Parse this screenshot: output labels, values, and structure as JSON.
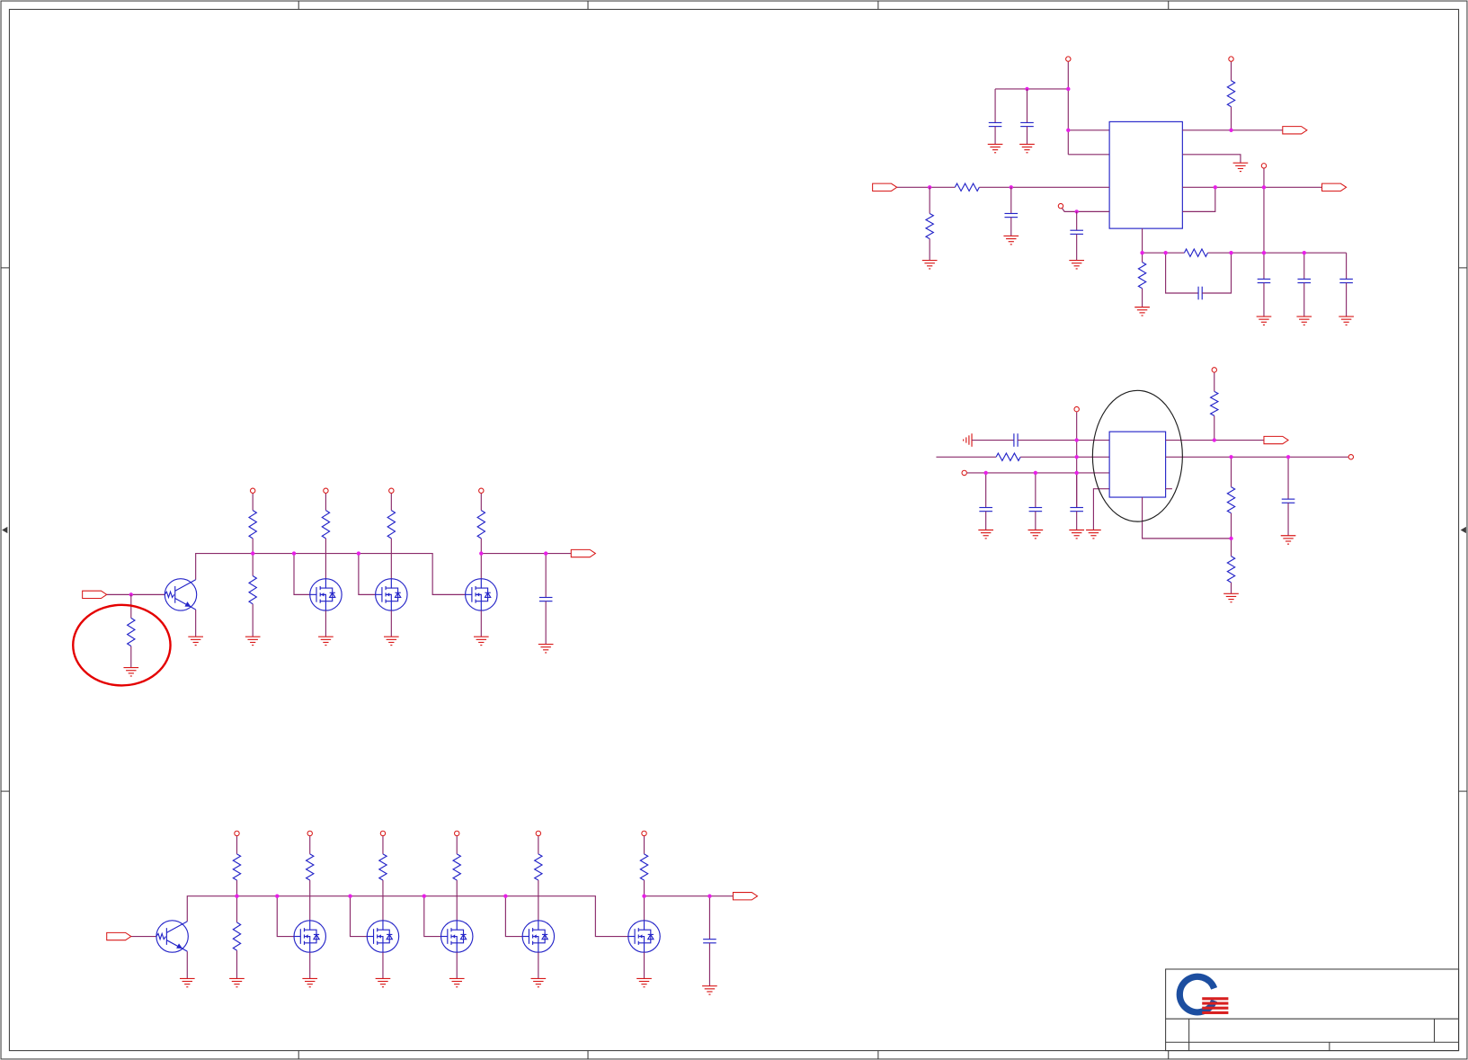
{
  "colors": {
    "background": "#ffffff",
    "wire": "#8a2a6a",
    "component": "#2424c8",
    "power_ground": "#d81818",
    "junction": "#e81ee8",
    "frame": "#3c3c3c",
    "highlight_red": "#e40000",
    "highlight_black": "#1e1e1e",
    "logo_blue": "#1c4ea0",
    "logo_red": "#d82020"
  }
}
